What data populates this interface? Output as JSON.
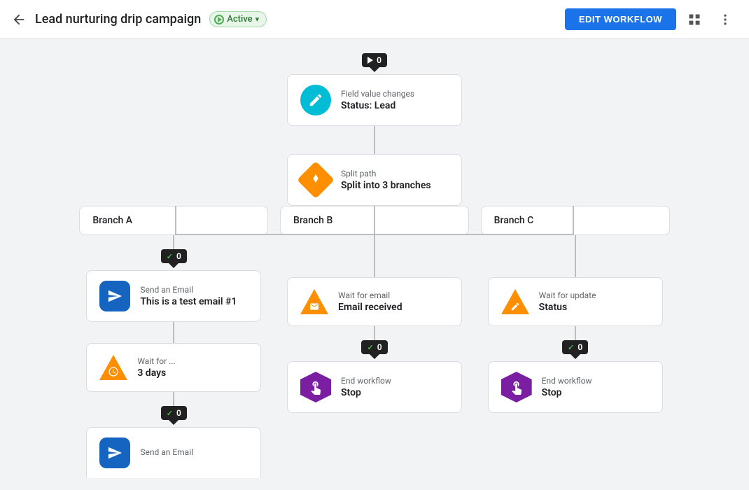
{
  "header": {
    "back_label": "←",
    "title": "Lead nurturing drip campaign",
    "status": "Active",
    "status_chevron": "▾",
    "edit_button": "EDIT WORKFLOW",
    "grid_icon": "⊞",
    "more_icon": "⋮"
  },
  "trigger": {
    "counter": "0",
    "label": "Field value changes",
    "value": "Status: Lead"
  },
  "split": {
    "label": "Split path",
    "value": "Split into 3 branches"
  },
  "branches": [
    {
      "name": "Branch A",
      "counter": "0",
      "nodes": [
        {
          "type": "email",
          "label": "Send an Email",
          "value": "This is a test email #1"
        },
        {
          "type": "wait",
          "label": "Wait for ...",
          "value": "3 days"
        }
      ],
      "bottom_counter": "0"
    },
    {
      "name": "Branch B",
      "nodes": [
        {
          "type": "waitEmail",
          "label": "Wait for email",
          "value": "Email received"
        }
      ],
      "end_counter": "0",
      "end": {
        "label": "End workflow",
        "value": "Stop"
      }
    },
    {
      "name": "Branch C",
      "nodes": [
        {
          "type": "waitUpdate",
          "label": "Wait for update",
          "value": "Status"
        }
      ],
      "end_counter": "0",
      "end": {
        "label": "End workflow",
        "value": "Stop"
      }
    }
  ],
  "icons": {
    "pencil": "✏",
    "split": "⇄",
    "email_send": "▶",
    "clock": "⏰",
    "email_recv": "✉",
    "hand": "✋",
    "pen": "✒"
  }
}
